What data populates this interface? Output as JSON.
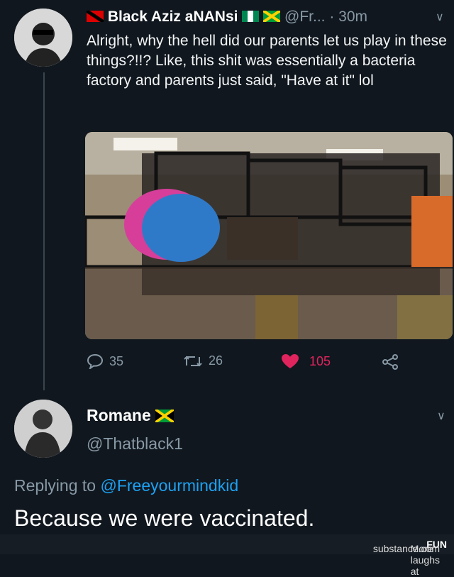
{
  "tweet": {
    "author_name": "Black Aziz aNANsi",
    "author_handle": "@Fr...",
    "time": "· 30m",
    "text": "Alright, why the hell did our parents let us play in these things?!!? Like, this shit was essentially a bacteria factory and parents just said, \"Have at it\" lol",
    "replies": "35",
    "retweets": "26",
    "likes": "105"
  },
  "reply": {
    "name": "Romane",
    "handle": "@Thatblack1",
    "replying_prefix": "Replying to",
    "replying_handle": "@Freeyourmindkid",
    "text": "Because we were vaccinated."
  },
  "footer": {
    "prefix": "More laughs at",
    "brand_bold": "FUN",
    "brand_rest": "substance.com"
  },
  "colors": {
    "background": "#10171e",
    "like": "#e0245e",
    "link": "#1da1f2",
    "muted": "#8899a6"
  }
}
